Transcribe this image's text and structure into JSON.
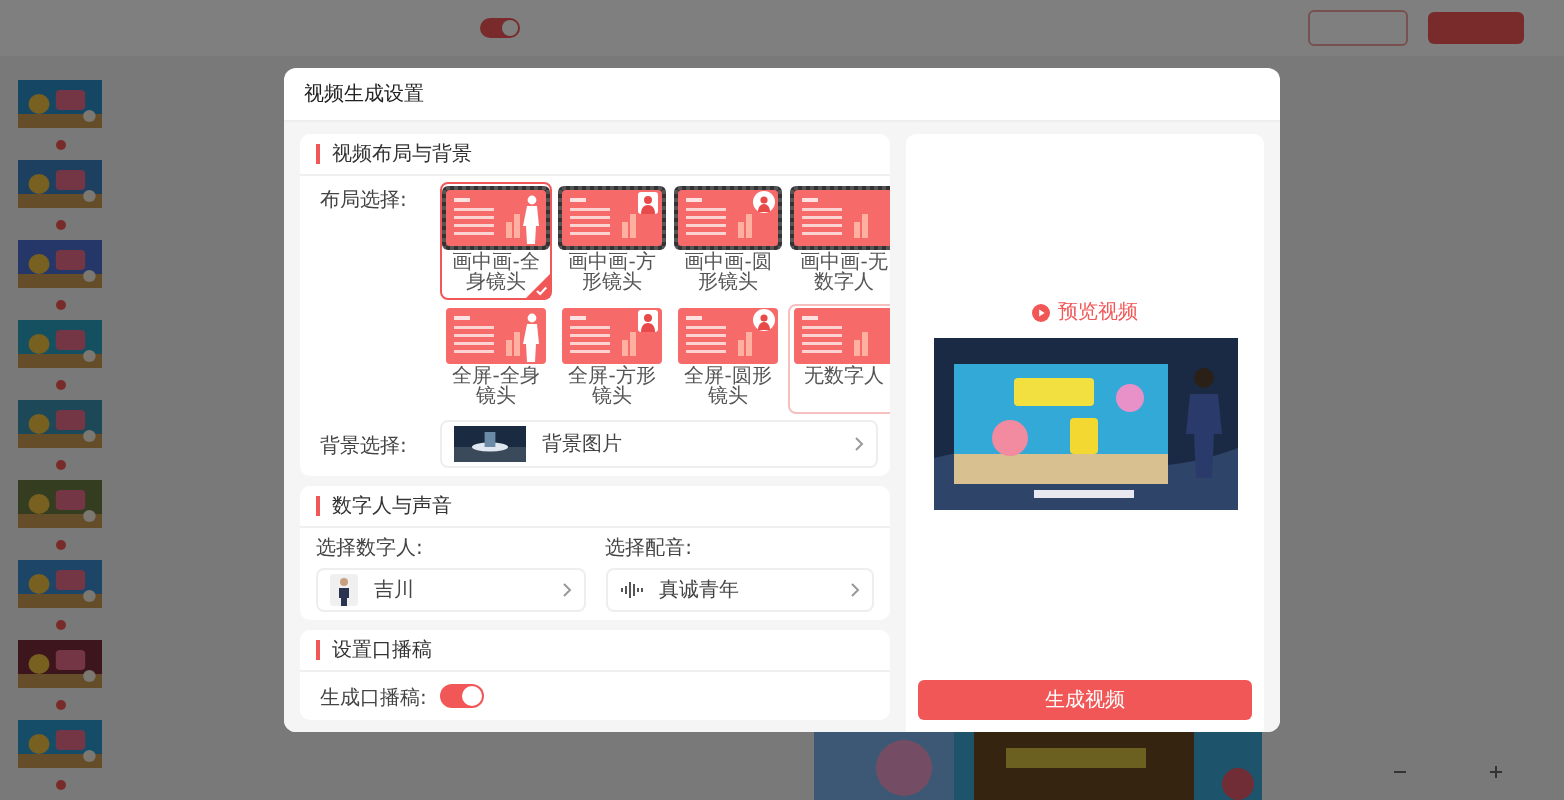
{
  "page": {
    "toggle_on": true
  },
  "modal": {
    "title": "视频生成设置"
  },
  "layout_section": {
    "heading": "视频布局与背景",
    "layout_label": "布局选择:",
    "layouts": [
      {
        "label": "画中画-全身镜头",
        "kind": "pipbody",
        "selected": true,
        "hovered": false
      },
      {
        "label": "画中画-方形镜头",
        "kind": "pipsquare",
        "selected": false,
        "hovered": false
      },
      {
        "label": "画中画-圆形镜头",
        "kind": "pipround",
        "selected": false,
        "hovered": false
      },
      {
        "label": "画中画-无数字人",
        "kind": "pipnone",
        "selected": false,
        "hovered": false
      },
      {
        "label": "全屏-全身镜头",
        "kind": "fullbody",
        "selected": false,
        "hovered": false
      },
      {
        "label": "全屏-方形镜头",
        "kind": "fullsquare",
        "selected": false,
        "hovered": false
      },
      {
        "label": "全屏-圆形镜头",
        "kind": "fullround",
        "selected": false,
        "hovered": false
      },
      {
        "label": "无数字人",
        "kind": "fullnone",
        "selected": false,
        "hovered": true
      }
    ],
    "background_label": "背景选择:",
    "background_value": "背景图片"
  },
  "avatar_section": {
    "heading": "数字人与声音",
    "avatar_label": "选择数字人:",
    "avatar_value": "吉川",
    "voice_label": "选择配音:",
    "voice_value": "真诚青年"
  },
  "script_section": {
    "heading": "设置口播稿",
    "toggle_label": "生成口播稿:",
    "on": true
  },
  "preview": {
    "link": "预览视频",
    "button": "生成视频"
  }
}
